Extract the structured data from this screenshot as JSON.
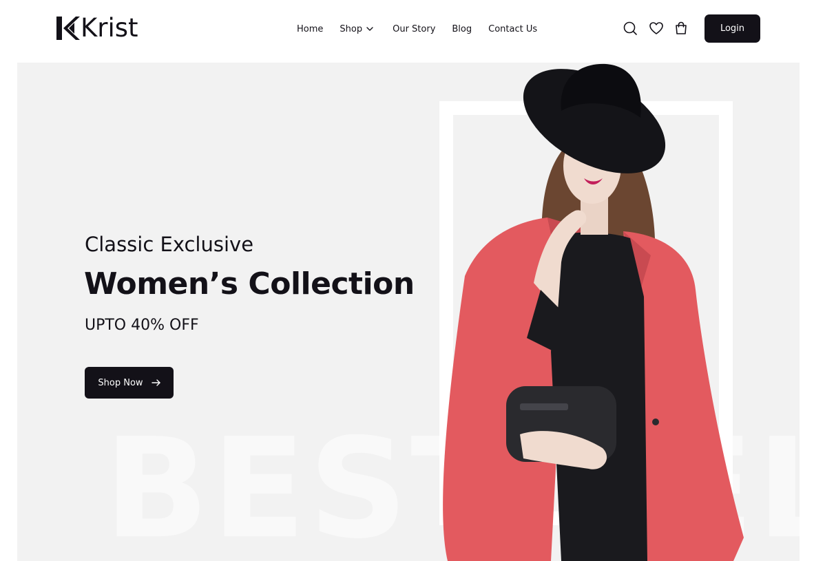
{
  "brand": {
    "name": "Krist",
    "logo_icon": "krist-k-mark-icon"
  },
  "nav": {
    "items": [
      {
        "label": "Home"
      },
      {
        "label": "Shop",
        "icon": "chevron-down-icon"
      },
      {
        "label": "Our Story"
      },
      {
        "label": "Blog"
      },
      {
        "label": "Contact Us"
      }
    ]
  },
  "header_icons": [
    "search-icon",
    "heart-icon",
    "shopping-bag-icon"
  ],
  "login_label": "Login",
  "hero": {
    "subtitle": "Classic Exclusive",
    "title": "Women’s Collection",
    "offer": "UPTO 40% OFF",
    "cta_label": "Shop Now",
    "cta_icon": "arrow-right-icon",
    "watermark": "BEST SELLER"
  },
  "colors": {
    "primary": "#131118",
    "hero_background": "#f2f2f2",
    "coat": "#e35a5f",
    "white": "#ffffff"
  }
}
